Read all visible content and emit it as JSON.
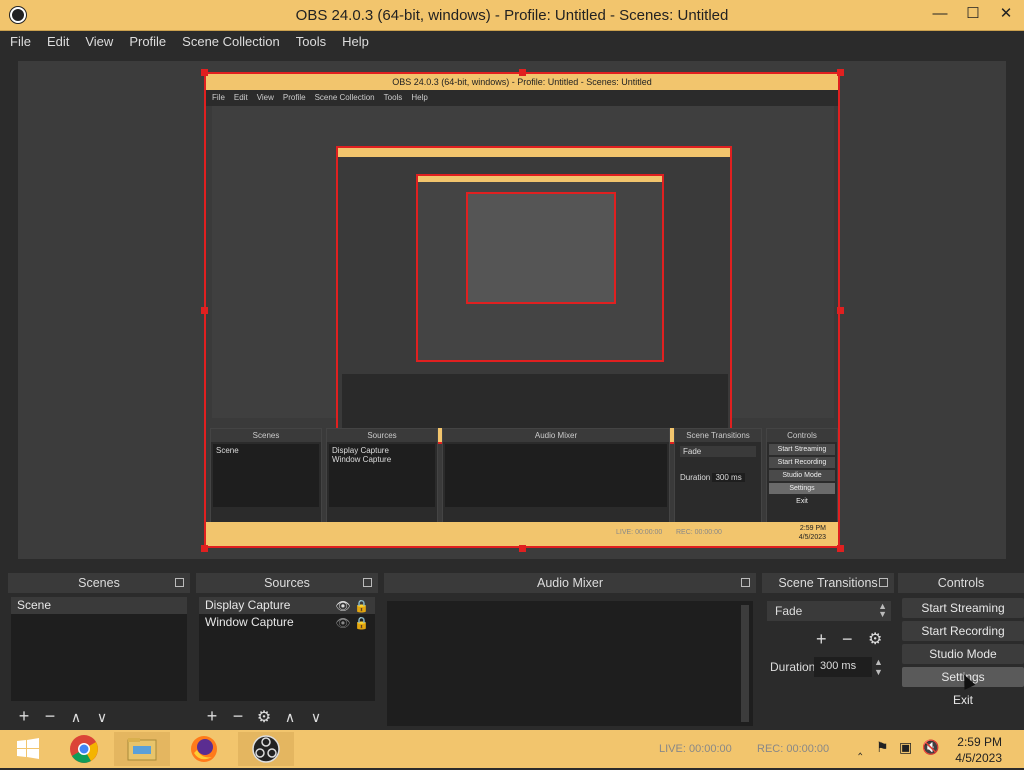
{
  "window": {
    "title": "OBS 24.0.3 (64-bit, windows) - Profile: Untitled - Scenes: Untitled",
    "minimize": "—",
    "maximize": "☐",
    "close": "✕"
  },
  "menu": [
    "File",
    "Edit",
    "View",
    "Profile",
    "Scene Collection",
    "Tools",
    "Help"
  ],
  "preview": {
    "nested_title": "OBS 24.0.3 (64-bit, windows) - Profile: Untitled - Scenes: Untitled",
    "nested_menu": [
      "File",
      "Edit",
      "View",
      "Profile",
      "Scene Collection",
      "Tools",
      "Help"
    ],
    "nested_docks": [
      "Scenes",
      "Sources",
      "Audio Mixer",
      "Scene Transitions",
      "Controls"
    ],
    "nested_scene": "Scene",
    "nested_sources": [
      "Display Capture",
      "Window Capture"
    ],
    "nested_transition": "Fade",
    "nested_duration_label": "Duration",
    "nested_duration": "300 ms",
    "nested_controls": [
      "Start Streaming",
      "Start Recording",
      "Studio Mode",
      "Settings",
      "Exit"
    ],
    "nested_live": "LIVE: 00:00:00",
    "nested_rec": "REC: 00:00:00",
    "nested_time": "2:59 PM",
    "nested_date": "4/5/2023"
  },
  "scenes": {
    "header": "Scenes",
    "items": [
      "Scene"
    ]
  },
  "sources": {
    "header": "Sources",
    "items": [
      "Display Capture",
      "Window Capture"
    ]
  },
  "mixer": {
    "header": "Audio Mixer"
  },
  "transitions": {
    "header": "Scene Transitions",
    "selected": "Fade",
    "duration_label": "Duration",
    "duration": "300 ms"
  },
  "controls": {
    "header": "Controls",
    "start_streaming": "Start Streaming",
    "start_recording": "Start Recording",
    "studio_mode": "Studio Mode",
    "settings": "Settings",
    "exit": "Exit"
  },
  "status": {
    "live": "LIVE: 00:00:00",
    "rec": "REC: 00:00:00"
  },
  "clock": {
    "time": "2:59 PM",
    "date": "4/5/2023"
  },
  "colors": {
    "accent_title": "#f2c56d",
    "selection": "#e02020",
    "panel": "#2b2b2b"
  }
}
